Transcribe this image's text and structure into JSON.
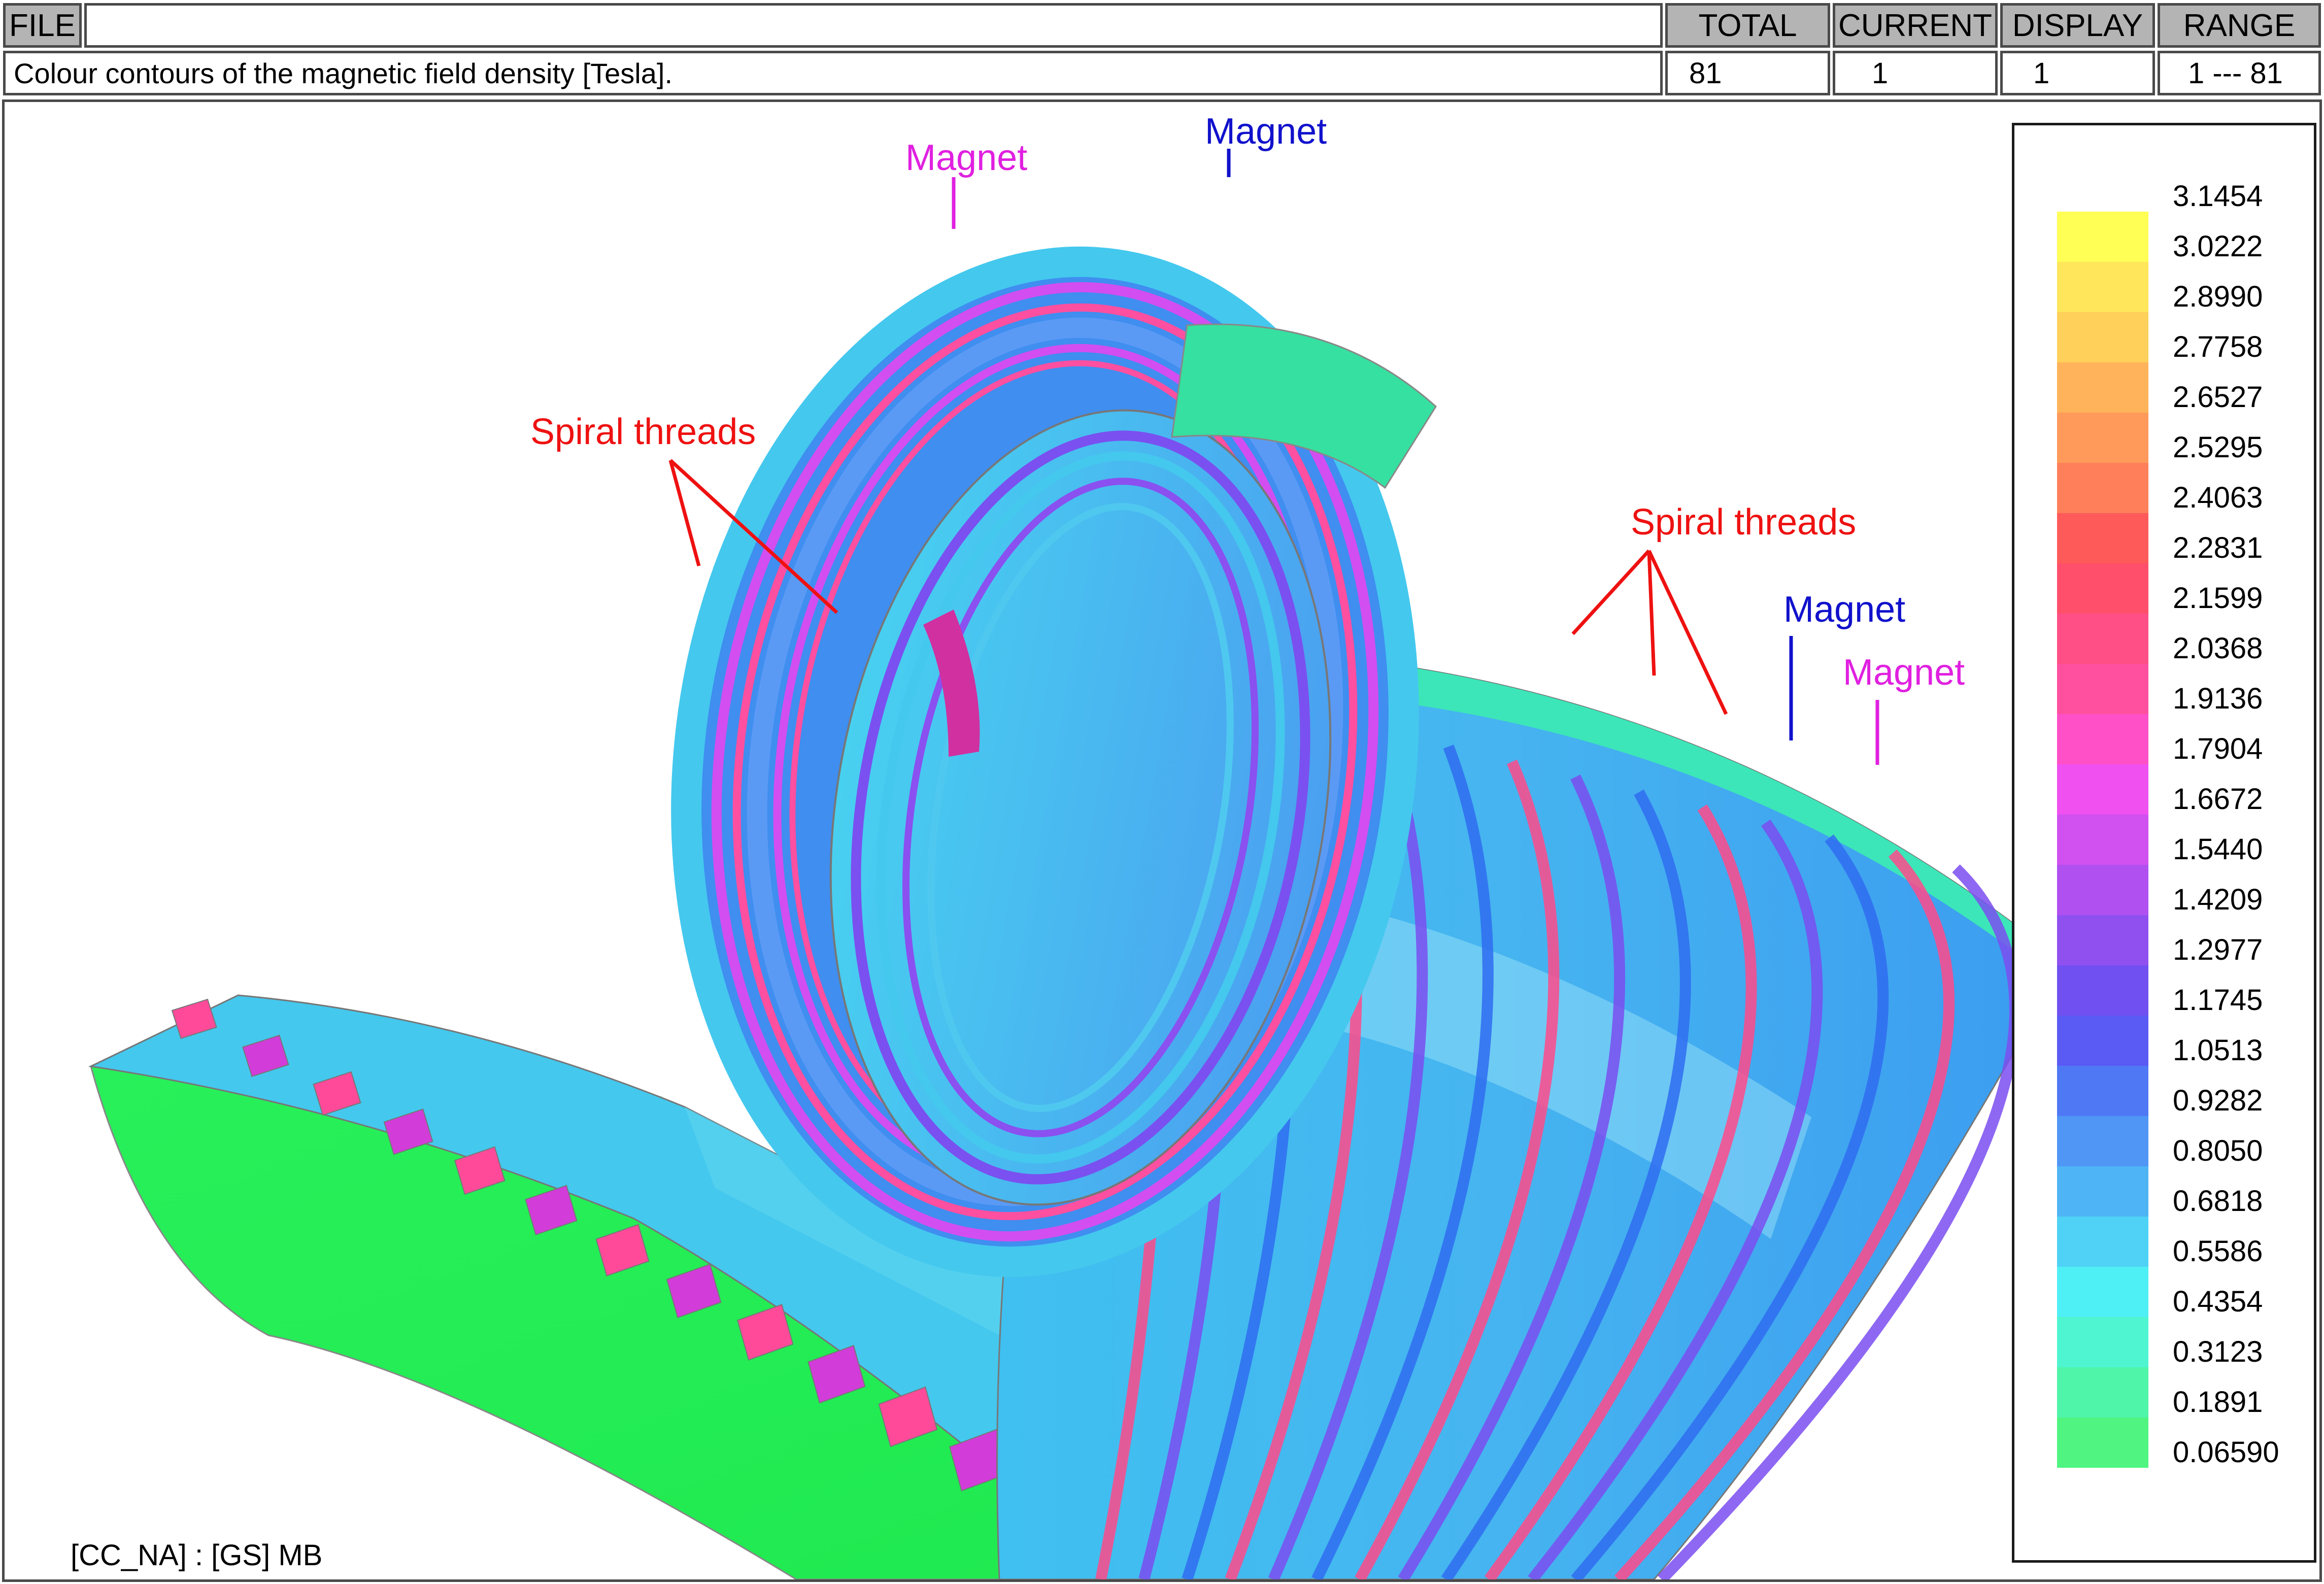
{
  "header": {
    "menu_file": "FILE",
    "description": "Colour contours of the magnetic field density [Tesla].",
    "columns": [
      {
        "label": "TOTAL",
        "value": "81"
      },
      {
        "label": "CURRENT",
        "value": "1"
      },
      {
        "label": "DISPLAY",
        "value": "1"
      },
      {
        "label": "RANGE",
        "value": "1  ---  81"
      }
    ]
  },
  "legend": {
    "values": [
      "3.1454",
      "3.0222",
      "2.8990",
      "2.7758",
      "2.6527",
      "2.5295",
      "2.4063",
      "2.2831",
      "2.1599",
      "2.0368",
      "1.9136",
      "1.7904",
      "1.6672",
      "1.5440",
      "1.4209",
      "1.2977",
      "1.1745",
      "1.0513",
      "0.9282",
      "0.8050",
      "0.6818",
      "0.5586",
      "0.4354",
      "0.3123",
      "0.1891",
      "0.06590"
    ],
    "colors": [
      "#ffff55",
      "#ffe65a",
      "#ffd05a",
      "#ffb35a",
      "#ff9a5a",
      "#ff7f5a",
      "#ff5a5a",
      "#ff4f6a",
      "#ff4f86",
      "#ff50a0",
      "#ff50c8",
      "#f050f0",
      "#d050f0",
      "#b050f0",
      "#9050f0",
      "#7050f0",
      "#5a5af5",
      "#4f78f5",
      "#4f96f5",
      "#4fb4f5",
      "#4fd2f5",
      "#4ff0f5",
      "#4ff5d0",
      "#4ff5a8",
      "#4ff580"
    ]
  },
  "annotations": {
    "magnet_top_left": "Magnet",
    "magnet_top_center": "Magnet",
    "spiral_threads_left": "Spiral threads",
    "spiral_threads_right": "Spiral threads",
    "magnet_right_blue": "Magnet",
    "magnet_right_magenta": "Magnet"
  },
  "footer": {
    "label": "[CC_NA] :  [GS] MB"
  }
}
